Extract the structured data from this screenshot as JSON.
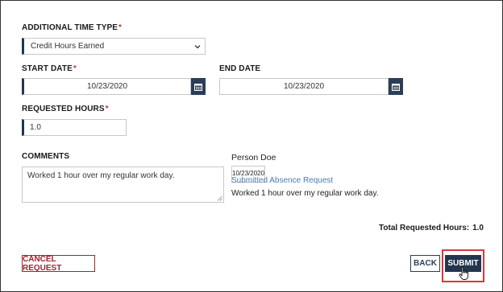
{
  "form": {
    "time_type_label": "ADDITIONAL TIME TYPE",
    "required_mark": "*",
    "time_type_value": "Credit Hours Earned",
    "start_date_label": "START DATE",
    "start_date_value": "10/23/2020",
    "end_date_label": "END DATE",
    "end_date_value": "10/23/2020",
    "requested_hours_label": "REQUESTED HOURS",
    "requested_hours_value": "1.0",
    "comments_label": "COMMENTS",
    "comments_value": "Worked 1 hour over my regular work day."
  },
  "comment_entry": {
    "author": "Person Doe",
    "date": "10/23/2020",
    "action": "Submitted Absence Request",
    "text": "Worked 1 hour over my regular work day."
  },
  "summary": {
    "total_label": "Total Requested Hours:",
    "total_value": "1.0"
  },
  "buttons": {
    "cancel": "CANCEL REQUEST",
    "back": "BACK",
    "submit": "SUBMIT"
  },
  "colors": {
    "navy": "#23364f",
    "required": "#c0392b",
    "cancel": "#a3232b",
    "link": "#4a7bb5",
    "highlight": "#d9363e"
  },
  "icons": {
    "calendar": "calendar-icon",
    "dropdown": "chevron-down-icon",
    "cursor": "hand-pointer-icon"
  }
}
